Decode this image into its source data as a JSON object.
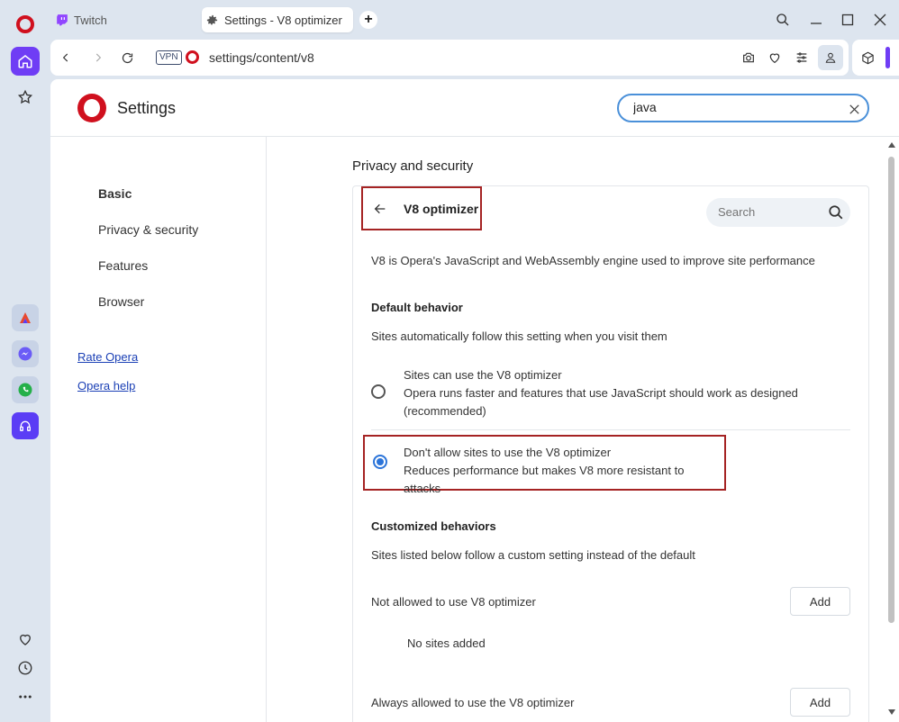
{
  "browser": {
    "tabs": [
      {
        "label": "Twitch",
        "icon": "twitch-icon"
      },
      {
        "label": "Settings - V8 optimizer",
        "icon": "gear-icon",
        "active": true
      }
    ],
    "address": {
      "vpn_label": "VPN",
      "url": "settings/content/v8"
    }
  },
  "settings": {
    "title": "Settings",
    "search_value": "java",
    "nav": {
      "basic": "Basic",
      "privacy": "Privacy & security",
      "features": "Features",
      "browser": "Browser",
      "rate": "Rate Opera",
      "help": "Opera help"
    },
    "section_title": "Privacy and security",
    "page": {
      "title": "V8 optimizer",
      "search_placeholder": "Search",
      "description": "V8 is Opera's JavaScript and WebAssembly engine used to improve site performance",
      "default_heading": "Default behavior",
      "default_desc": "Sites automatically follow this setting when you visit them",
      "option_allow": {
        "label": "Sites can use the V8 optimizer",
        "desc_line1": "Opera runs faster and features that use JavaScript should work as designed",
        "desc_line2": "(recommended)"
      },
      "option_block": {
        "label": "Don't allow sites to use the V8 optimizer",
        "desc": "Reduces performance but makes V8 more resistant to attacks"
      },
      "selected_option": "option_block",
      "custom_heading": "Customized behaviors",
      "custom_desc": "Sites listed below follow a custom setting instead of the default",
      "not_allowed_label": "Not allowed to use V8 optimizer",
      "add_label": "Add",
      "no_sites": "No sites added",
      "always_allowed_label": "Always allowed to use the V8 optimizer"
    }
  },
  "colors": {
    "accent": "#6f3df5",
    "opera_red": "#d0101e",
    "highlight_border": "#a52323",
    "radio_selected": "#2b74d9"
  }
}
